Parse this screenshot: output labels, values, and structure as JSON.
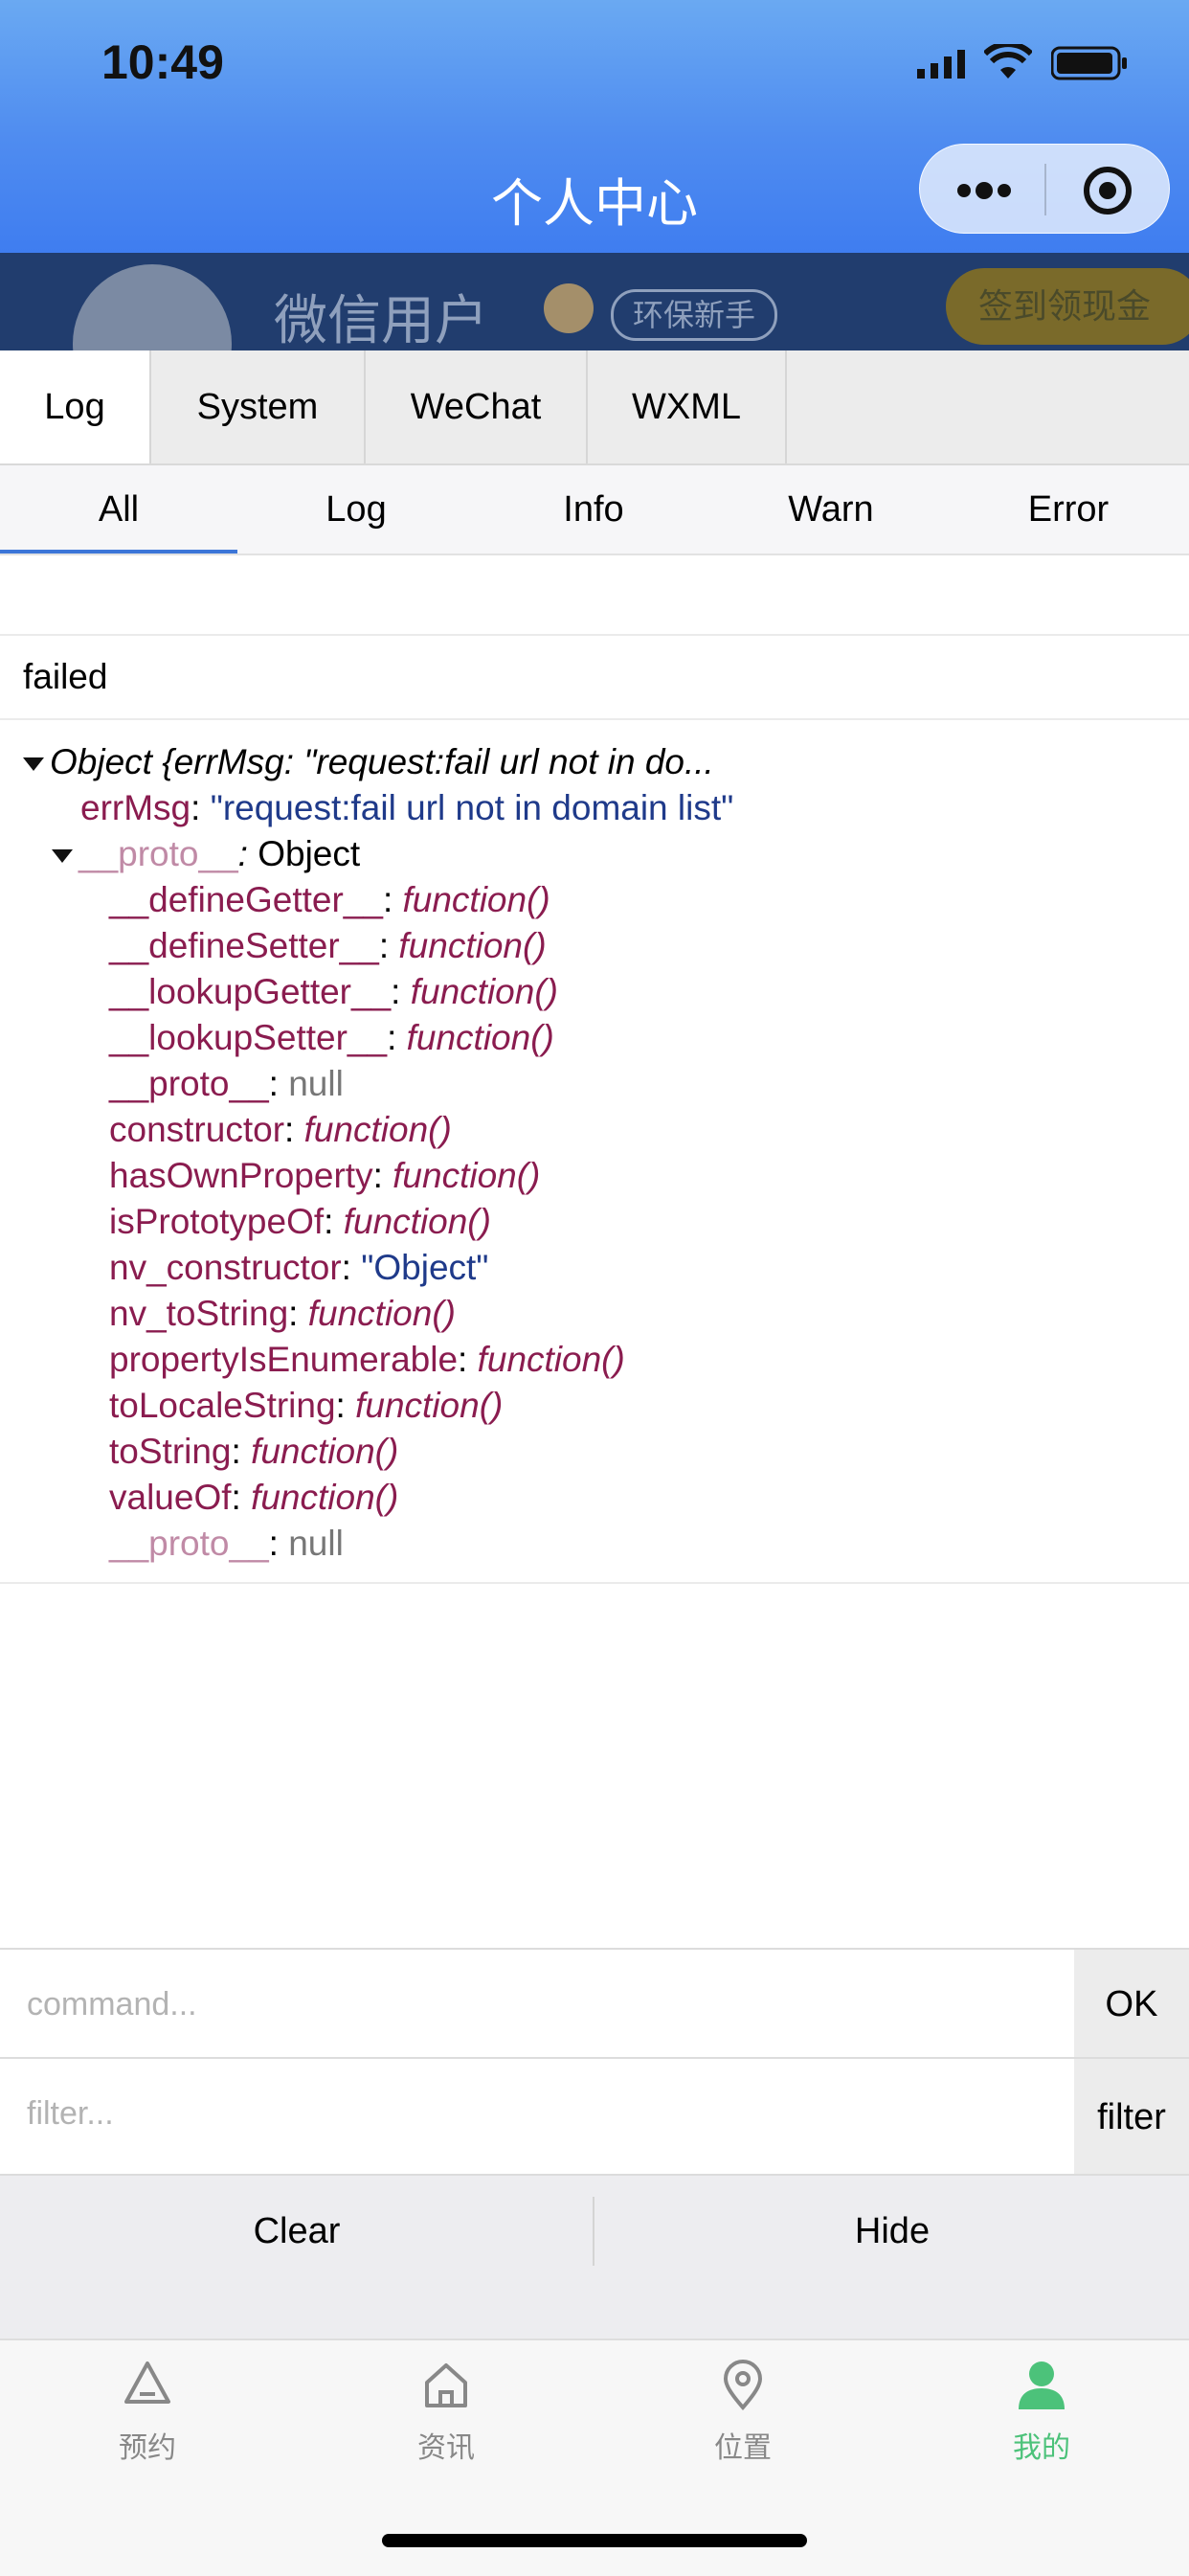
{
  "status_bar": {
    "time": "10:49"
  },
  "header": {
    "title": "个人中心"
  },
  "profile": {
    "username": "微信用户",
    "badge": "环保新手",
    "signin_label": "签到领现金"
  },
  "main_tabs": [
    "Log",
    "System",
    "WeChat",
    "WXML"
  ],
  "sub_tabs": [
    "All",
    "Log",
    "Info",
    "Warn",
    "Error"
  ],
  "log": {
    "failed_text": "failed",
    "object_summary": "Object {errMsg: \"request:fail url not in do...",
    "errmsg_key": "errMsg",
    "errmsg_value": "\"request:fail url not in domain list\"",
    "proto_key": "__proto__",
    "proto_type": "Object",
    "members": [
      {
        "key": "__defineGetter__",
        "value": "function()",
        "kind": "fn"
      },
      {
        "key": "__defineSetter__",
        "value": "function()",
        "kind": "fn"
      },
      {
        "key": "__lookupGetter__",
        "value": "function()",
        "kind": "fn"
      },
      {
        "key": "__lookupSetter__",
        "value": "function()",
        "kind": "fn"
      },
      {
        "key": "__proto__",
        "value": "null",
        "kind": "null"
      },
      {
        "key": "constructor",
        "value": "function()",
        "kind": "fn"
      },
      {
        "key": "hasOwnProperty",
        "value": "function()",
        "kind": "fn"
      },
      {
        "key": "isPrototypeOf",
        "value": "function()",
        "kind": "fn"
      },
      {
        "key": "nv_constructor",
        "value": "\"Object\"",
        "kind": "str"
      },
      {
        "key": "nv_toString",
        "value": "function()",
        "kind": "fn"
      },
      {
        "key": "propertyIsEnumerable",
        "value": "function()",
        "kind": "fn"
      },
      {
        "key": "toLocaleString",
        "value": "function()",
        "kind": "fn"
      },
      {
        "key": "toString",
        "value": "function()",
        "kind": "fn"
      },
      {
        "key": "valueOf",
        "value": "function()",
        "kind": "fn"
      },
      {
        "key": "__proto__",
        "value": "null",
        "kind": "null-dim"
      }
    ]
  },
  "command": {
    "placeholder": "command...",
    "ok_label": "OK"
  },
  "filter": {
    "placeholder": "filter...",
    "button_label": "filter"
  },
  "actions": {
    "clear_label": "Clear",
    "hide_label": "Hide"
  },
  "tabbar": {
    "items": [
      {
        "label": "预约",
        "icon": "recycle-icon"
      },
      {
        "label": "资讯",
        "icon": "home-icon"
      },
      {
        "label": "位置",
        "icon": "location-pin-icon"
      },
      {
        "label": "我的",
        "icon": "user-icon"
      }
    ],
    "active_color": "#4cc27a"
  }
}
